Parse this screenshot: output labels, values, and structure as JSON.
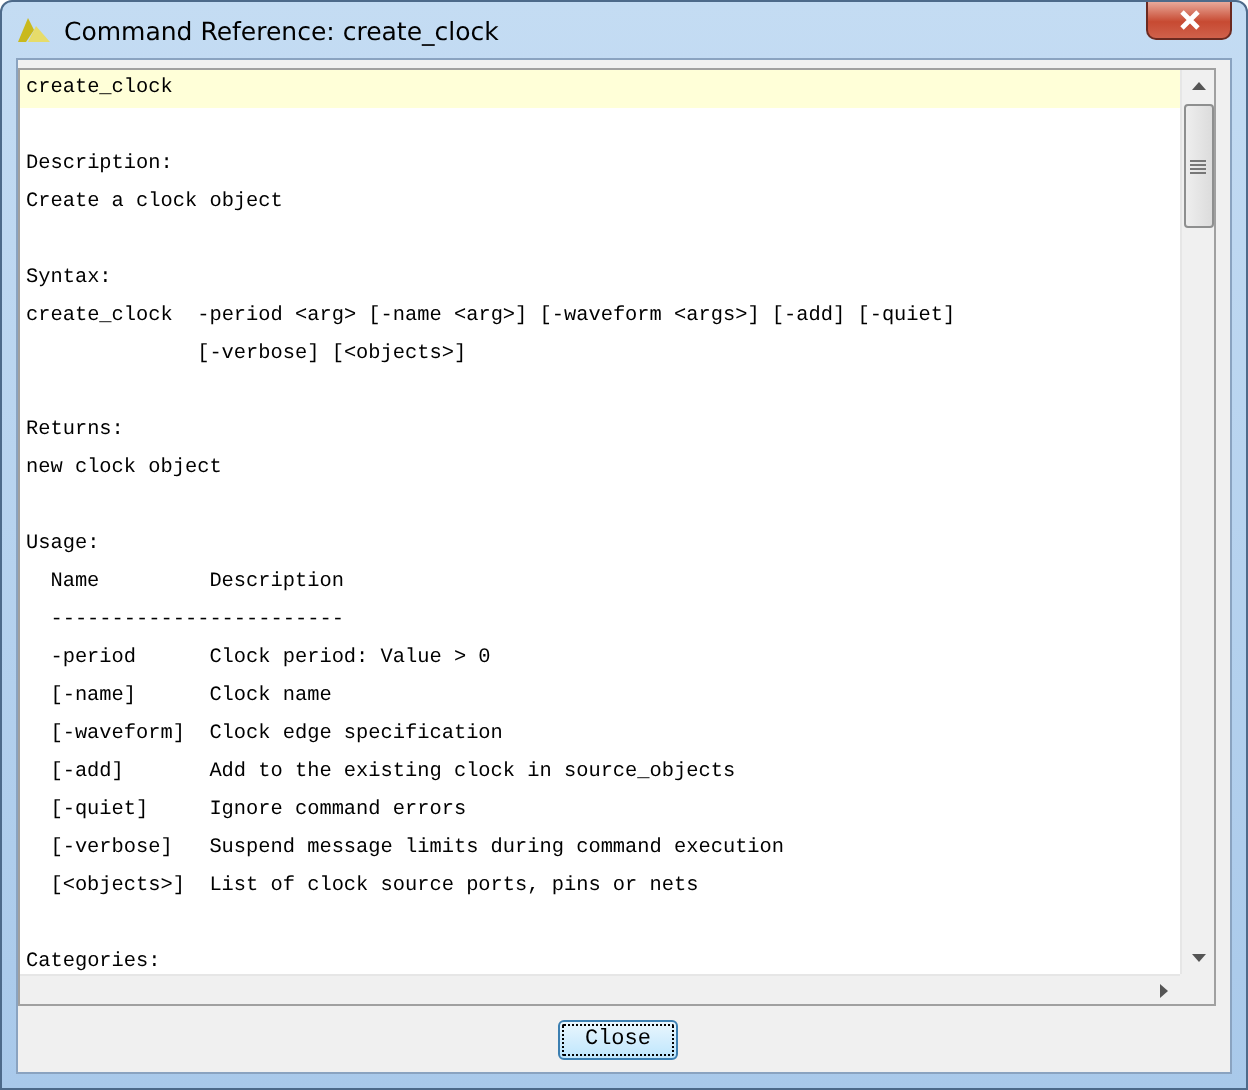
{
  "window": {
    "title": "Command Reference: create_clock"
  },
  "reference": {
    "command": "create_clock",
    "description_heading": "Description:",
    "description": "Create a clock object",
    "syntax_heading": "Syntax:",
    "syntax_lines": [
      "create_clock  -period <arg> [-name <arg>] [-waveform <args>] [-add] [-quiet]",
      "[-verbose] [<objects>]"
    ],
    "returns_heading": "Returns:",
    "returns": "new clock object",
    "usage_heading": "Usage:",
    "usage_columns": [
      "Name",
      "Description"
    ],
    "usage_rule": "------------------------",
    "usage_rows": [
      {
        "name": "-period",
        "description": "Clock period: Value > 0"
      },
      {
        "name": "[-name]",
        "description": "Clock name"
      },
      {
        "name": "[-waveform]",
        "description": "Clock edge specification"
      },
      {
        "name": "[-add]",
        "description": "Add to the existing clock in source_objects"
      },
      {
        "name": "[-quiet]",
        "description": "Ignore command errors"
      },
      {
        "name": "[-verbose]",
        "description": "Suspend message limits during command execution"
      },
      {
        "name": "[<objects>]",
        "description": "List of clock source ports, pins or nets"
      }
    ],
    "categories_heading": "Categories:"
  },
  "buttons": [
    {
      "label": "Close",
      "focused": true
    }
  ]
}
